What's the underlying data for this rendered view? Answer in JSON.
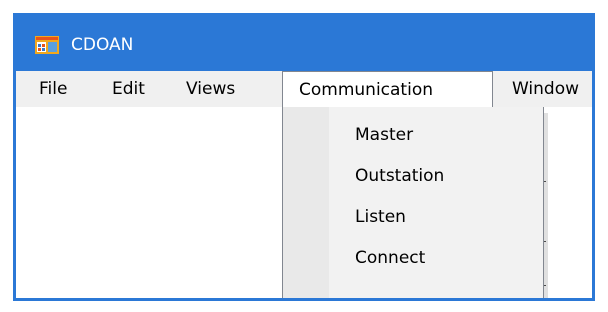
{
  "window": {
    "title": "CDOAN",
    "app_icon": "app-window-icon",
    "title_bar_color": "#2b78d6",
    "menubar_color": "#f0f0f0"
  },
  "menubar": {
    "items": [
      {
        "label": "File"
      },
      {
        "label": "Edit"
      },
      {
        "label": "Views"
      },
      {
        "label": "Communication"
      },
      {
        "label": "Window"
      }
    ],
    "open_menu": "Communication"
  },
  "dropdown": {
    "items": [
      {
        "label": "Master"
      },
      {
        "label": "Outstation"
      },
      {
        "label": "Listen"
      },
      {
        "label": "Connect"
      }
    ]
  }
}
